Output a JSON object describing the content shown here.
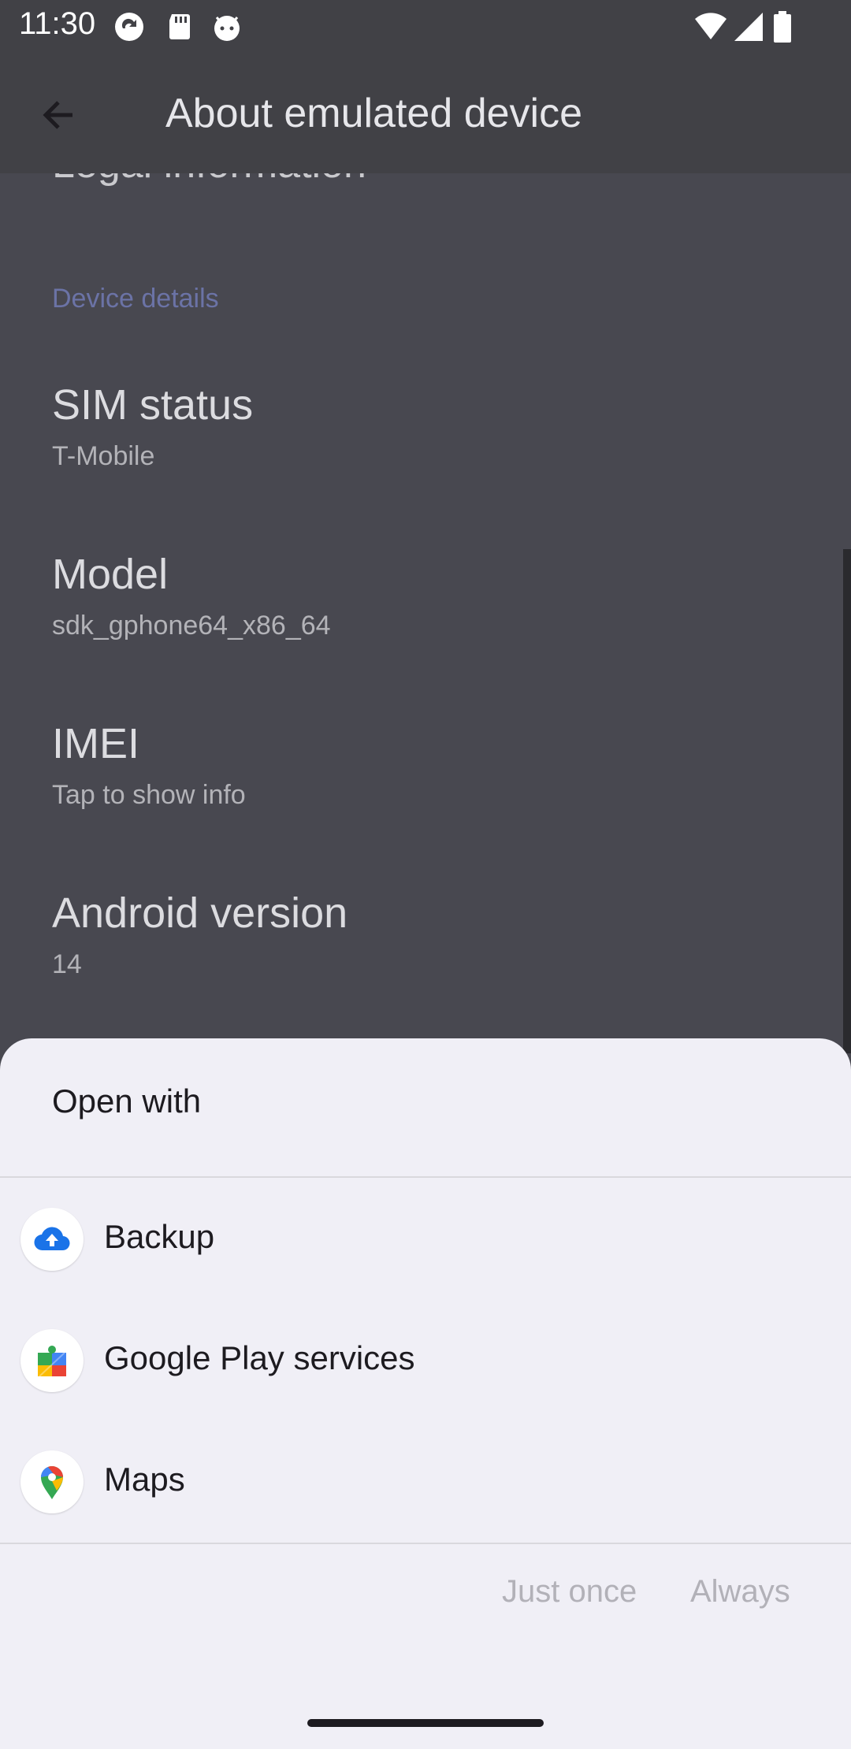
{
  "status_bar": {
    "time": "11:30"
  },
  "app_bar": {
    "title": "About emulated device"
  },
  "content": {
    "partial_item": "Legal information",
    "section_header": "Device details",
    "items": [
      {
        "title": "SIM status",
        "summary": "T-Mobile"
      },
      {
        "title": "Model",
        "summary": "sdk_gphone64_x86_64"
      },
      {
        "title": "IMEI",
        "summary": "Tap to show info"
      },
      {
        "title": "Android version",
        "summary": "14"
      }
    ]
  },
  "sheet": {
    "title": "Open with",
    "apps": [
      {
        "label": "Backup",
        "icon": "cloud-upload-icon"
      },
      {
        "label": "Google Play services",
        "icon": "puzzle-icon"
      },
      {
        "label": "Maps",
        "icon": "map-pin-icon"
      }
    ],
    "buttons": {
      "just_once": "Just once",
      "always": "Always"
    }
  },
  "colors": {
    "accent": "#6b73a6",
    "sheet_bg": "#f0eff6",
    "scrim": "#484850"
  }
}
